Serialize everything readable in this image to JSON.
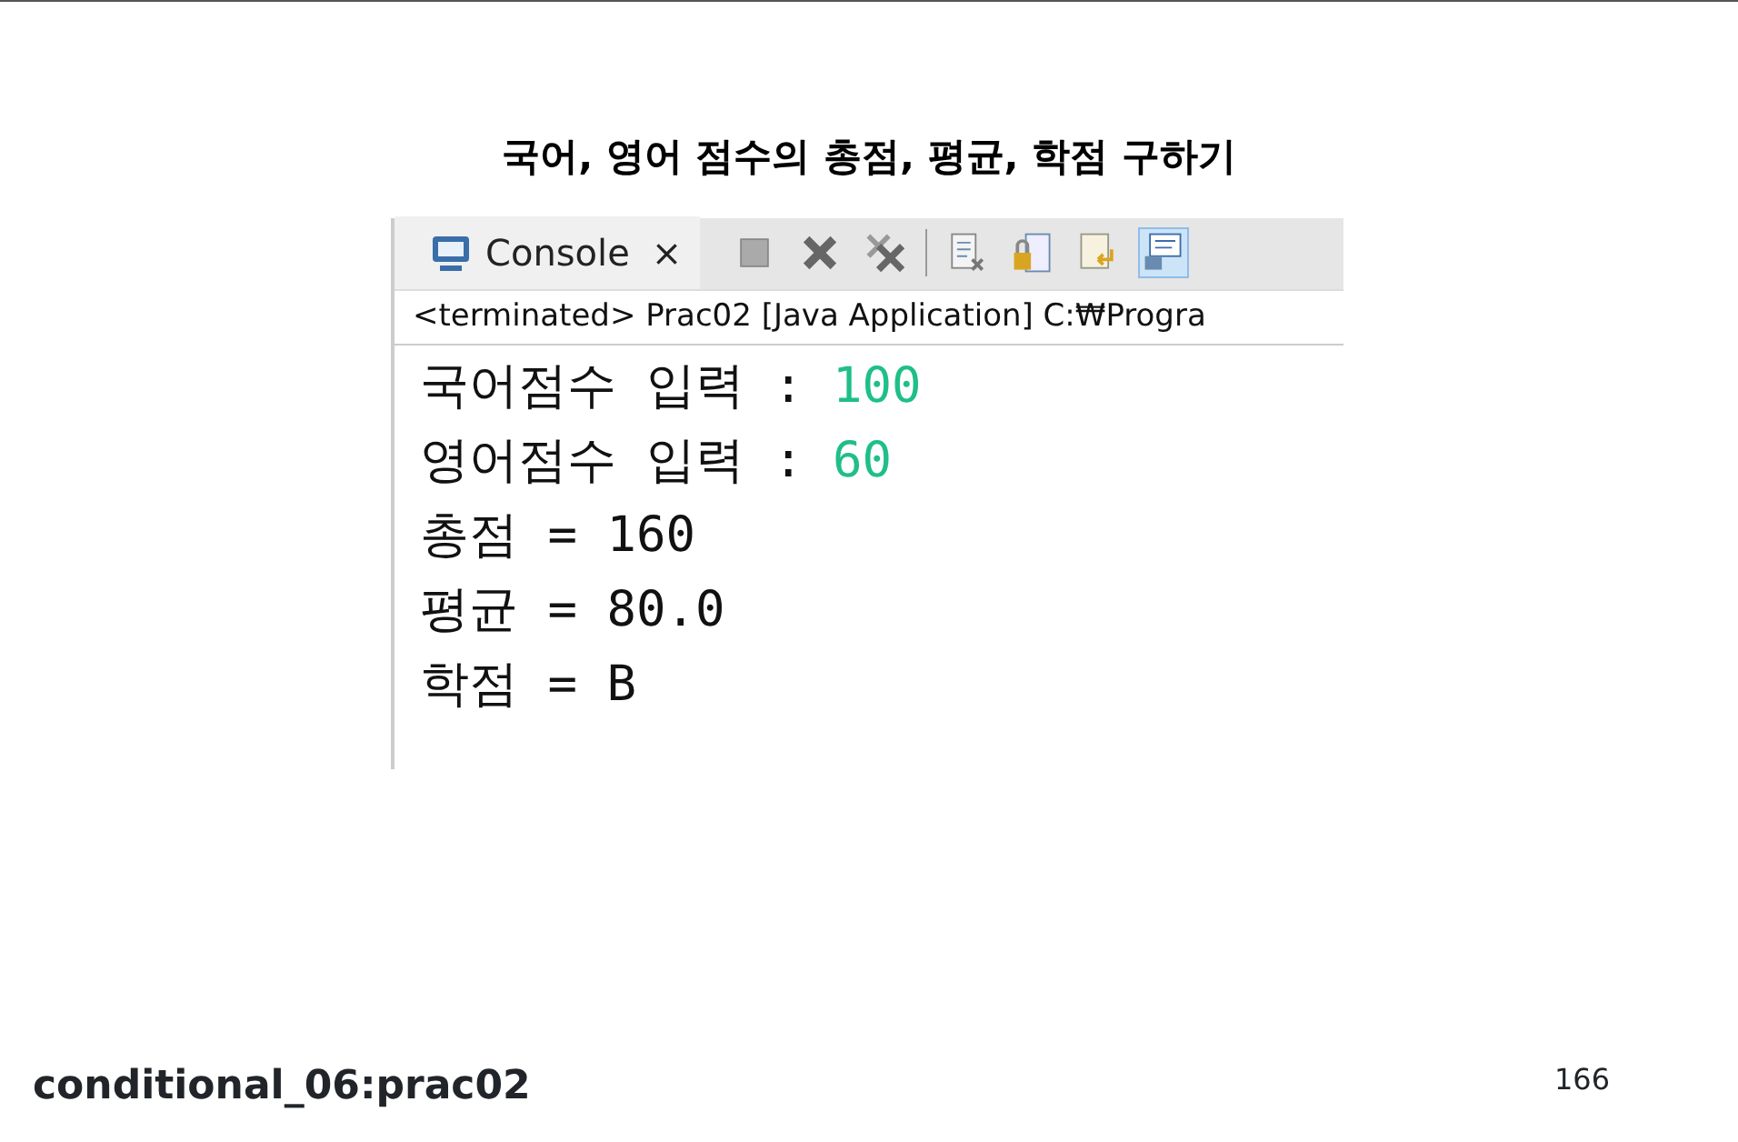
{
  "slide_title": "국어, 영어 점수의 총점, 평균, 학점 구하기",
  "console": {
    "tab": {
      "label": "Console",
      "close": "×"
    },
    "toolbar": [
      {
        "selected": false
      },
      {
        "selected": false
      },
      {
        "selected": false
      },
      {
        "selected": false
      },
      {
        "selected": false
      },
      {
        "selected": false
      },
      {
        "selected": true
      }
    ],
    "status": "<terminated> Prac02 [Java Application] C:₩Progra",
    "lines": [
      {
        "text": "국어점수 입력 : ",
        "input": "100"
      },
      {
        "text": "영어점수 입력 : ",
        "input": "60"
      },
      {
        "text": "총점 = 160"
      },
      {
        "text": "평균 = 80.0"
      },
      {
        "text": "학점 = B"
      }
    ]
  },
  "footer": {
    "label": "conditional_06:prac02",
    "page_number": "166"
  }
}
